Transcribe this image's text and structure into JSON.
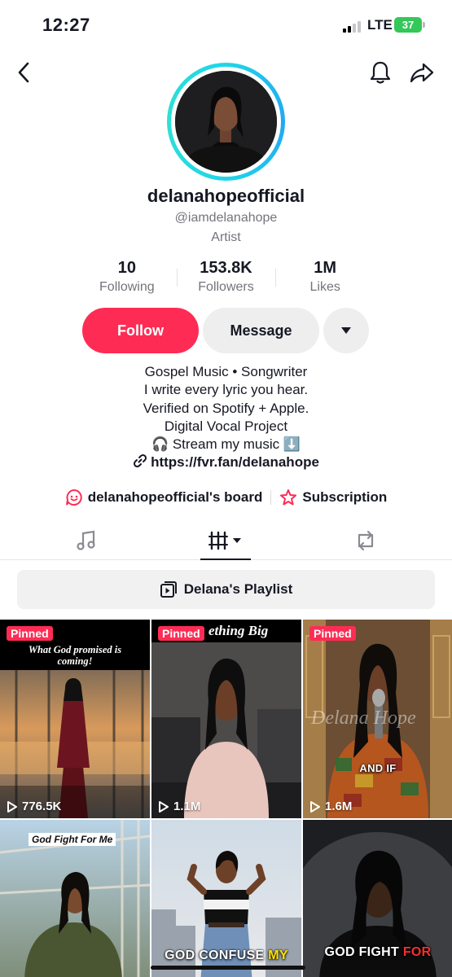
{
  "status_bar": {
    "time": "12:27",
    "network": "LTE",
    "battery": "37"
  },
  "profile": {
    "display_name": "delanahopeofficial",
    "handle": "@iamdelanahope",
    "category": "Artist",
    "stats": [
      {
        "value": "10",
        "label": "Following"
      },
      {
        "value": "153.8K",
        "label": "Followers"
      },
      {
        "value": "1M",
        "label": "Likes"
      }
    ],
    "buttons": {
      "follow": "Follow",
      "message": "Message"
    },
    "bio_lines": [
      "Gospel Music • Songwriter",
      "I write every lyric you hear.",
      "Verified on Spotify + Apple.",
      "Digital Vocal Project",
      "🎧 Stream my music ⬇️"
    ],
    "link": "https://fvr.fan/delanahope",
    "board": "delanahopeofficial's board",
    "subscription": "Subscription",
    "playlist": "Delana's Playlist"
  },
  "videos": [
    {
      "pinned": "Pinned",
      "caption": "What God promised is coming!",
      "views": "776.5K"
    },
    {
      "pinned": "Pinned",
      "caption": "ething Big",
      "views": "1.1M"
    },
    {
      "pinned": "Pinned",
      "caption": "AND IF",
      "watermark": "Delana Hope",
      "views": "1.6M"
    },
    {
      "caption": "God Fight For Me",
      "subtitle": ""
    },
    {
      "subtitle_parts": [
        "GOD CONFUSE ",
        "MY"
      ]
    },
    {
      "subtitle_parts": [
        "GOD FIGHT ",
        "FOR"
      ]
    }
  ],
  "colors": {
    "accent": "#fe2c55",
    "avatar_ring": "#1fd6e8",
    "battery": "#34c759"
  }
}
